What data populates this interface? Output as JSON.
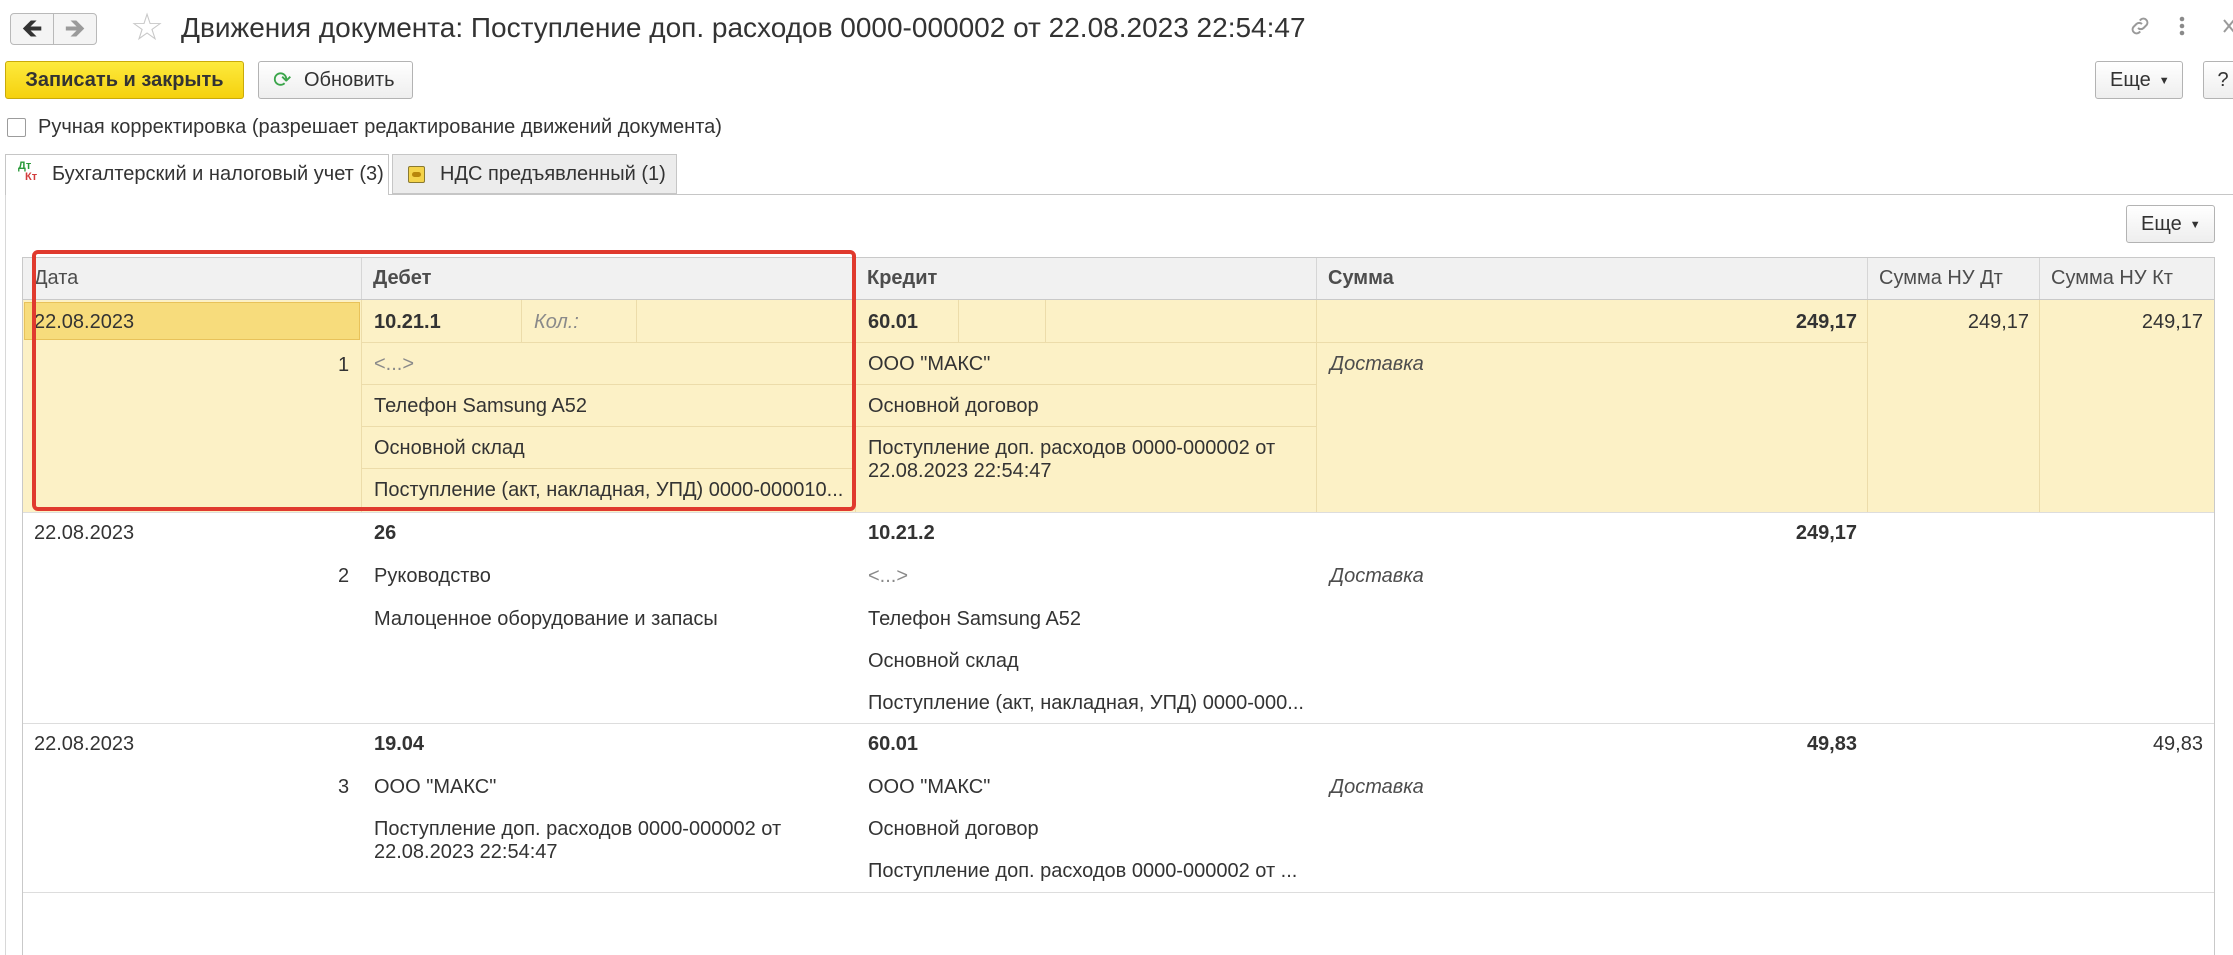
{
  "window": {
    "title": "Движения документа: Поступление доп. расходов 0000-000002 от 22.08.2023 22:54:47",
    "icons": [
      "back-arrow-icon",
      "forward-arrow-icon",
      "favorite-star-icon",
      "link-icon",
      "more-vertical-icon",
      "close-icon"
    ]
  },
  "toolbar": {
    "save_close_label": "Записать и закрыть",
    "refresh_label": "Обновить",
    "more_label": "Еще",
    "help_label": "?"
  },
  "manual_correction": {
    "label": "Ручная корректировка (разрешает редактирование движений документа)",
    "checked": false
  },
  "tabs": [
    {
      "label": "Бухгалтерский и налоговый учет (3)",
      "icon": "dt-kt-icon",
      "active": true
    },
    {
      "label": "НДС предъявленный (1)",
      "icon": "register-icon",
      "active": false
    }
  ],
  "tab_icon_text": {
    "dt": "Дт",
    "kt": "Кт"
  },
  "table_toolbar": {
    "more_label": "Еще"
  },
  "table": {
    "columns": [
      "Дата",
      "Дебет",
      "Кредит",
      "Сумма",
      "Сумма НУ Дт",
      "Сумма НУ Кт"
    ],
    "rows": [
      {
        "date": "22.08.2023",
        "num": "1",
        "debit_account": "10.21.1",
        "qty_label": "Кол.:",
        "debit_lines": [
          "<...>",
          "Телефон Samsung A52",
          "Основной склад",
          "Поступление (акт, накладная, УПД) 0000-000010..."
        ],
        "credit_account": "60.01",
        "credit_lines": [
          "ООО \"МАКС\"",
          "Основной договор",
          "Поступление доп. расходов 0000-000002 от 22.08.2023 22:54:47"
        ],
        "sum": "249,17",
        "content": "Доставка",
        "nu_dt": "249,17",
        "nu_kt": "249,17",
        "selected": true
      },
      {
        "date": "22.08.2023",
        "num": "2",
        "debit_account": "26",
        "debit_lines": [
          "Руководство",
          "Малоценное оборудование и запасы"
        ],
        "credit_account": "10.21.2",
        "credit_lines": [
          "<...>",
          "Телефон Samsung A52",
          "Основной склад",
          "Поступление (акт, накладная, УПД) 0000-000..."
        ],
        "sum": "249,17",
        "content": "Доставка",
        "nu_dt": "",
        "nu_kt": "",
        "selected": false
      },
      {
        "date": "22.08.2023",
        "num": "3",
        "debit_account": "19.04",
        "debit_lines": [
          "ООО \"МАКС\"",
          "Поступление доп. расходов 0000-000002 от 22.08.2023 22:54:47"
        ],
        "credit_account": "60.01",
        "credit_lines": [
          "ООО \"МАКС\"",
          "Основной договор",
          "Поступление доп. расходов 0000-000002 от ..."
        ],
        "sum": "49,83",
        "content": "Доставка",
        "nu_dt": "",
        "nu_kt": "49,83",
        "selected": false
      }
    ]
  },
  "annotation": {
    "color": "#e03a2e"
  },
  "colors": {
    "selected_row": "#fcf1c6",
    "primary_button": "#f5d10e"
  }
}
